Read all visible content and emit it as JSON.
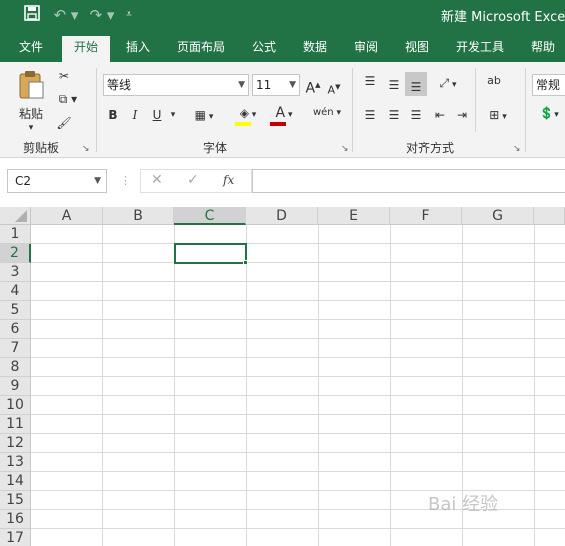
{
  "window": {
    "title": "新建 Microsoft Excel 工"
  },
  "quick_access": {
    "save_icon": "save-icon",
    "undo_icon": "undo-icon",
    "redo_icon": "redo-icon",
    "customize_icon": "customize-icon"
  },
  "tabs": [
    {
      "label": "文件"
    },
    {
      "label": "开始"
    },
    {
      "label": "插入"
    },
    {
      "label": "页面布局"
    },
    {
      "label": "公式"
    },
    {
      "label": "数据"
    },
    {
      "label": "审阅"
    },
    {
      "label": "视图"
    },
    {
      "label": "开发工具"
    },
    {
      "label": "帮助"
    }
  ],
  "ribbon": {
    "clipboard": {
      "paste_label": "粘贴",
      "group_label": "剪贴板"
    },
    "font": {
      "font_name": "等线",
      "font_size": "11",
      "grow": "A",
      "shrink": "A",
      "bold": "B",
      "italic": "I",
      "underline": "U",
      "font_color_letter": "A",
      "phonetic": "wén",
      "group_label": "字体"
    },
    "alignment": {
      "group_label": "对齐方式",
      "wrap_label": "ab"
    },
    "number": {
      "format": "常规"
    }
  },
  "formula_bar": {
    "name_box": "C2",
    "cancel": "✕",
    "confirm": "✓",
    "fx": "fx",
    "value": ""
  },
  "sheet": {
    "columns": [
      "A",
      "B",
      "C",
      "D",
      "E",
      "F",
      "G"
    ],
    "rows": [
      "1",
      "2",
      "3",
      "4",
      "5",
      "6",
      "7",
      "8",
      "9",
      "10",
      "11",
      "12",
      "13",
      "14",
      "15",
      "16",
      "17"
    ],
    "active_cell": "C2"
  },
  "watermark": "Bai 经验",
  "colors": {
    "accent": "#217346",
    "font_color_bar": "#c00000",
    "fill_color_bar": "#ffff00"
  }
}
